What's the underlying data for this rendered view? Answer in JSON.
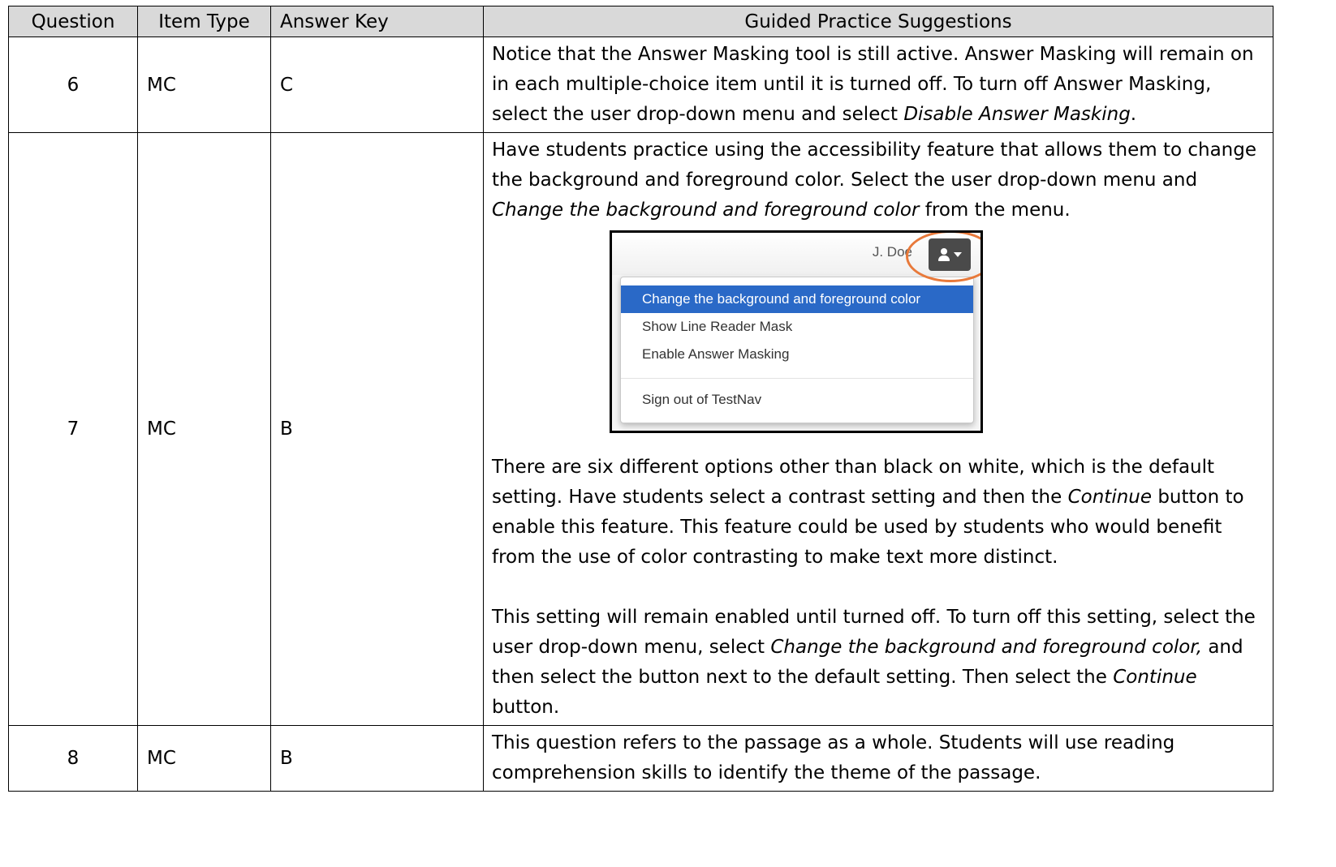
{
  "table": {
    "headers": [
      "Question",
      "Item Type",
      "Answer Key",
      "Guided Practice Suggestions"
    ],
    "rows": [
      {
        "question": "6",
        "item_type": "MC",
        "answer_key": "C",
        "text": "Notice that the Answer Masking tool is still active. Answer Masking will remain on in each multiple-choice item until it is turned off. To turn off Answer Masking, select the user drop-down menu and select ",
        "em": "Disable Answer Masking",
        "end": "."
      },
      {
        "question": "7",
        "item_type": "MC",
        "answer_key": "B",
        "p1": "Have students practice using the accessibility feature that allows them to change the background and foreground color. Select the user drop-down menu and ",
        "p1_em": "Change the background and foreground color",
        "p1_end": " from the menu.",
        "p2": "There are six different options other than black on white, which is the default setting. Have students select a contrast setting and then the ",
        "p2_em": "Continue",
        "p2_end": " button to enable this feature. This feature could be used by students who would benefit from the use of color contrasting to make text more distinct.",
        "p3": "This setting will remain enabled until turned off. To turn off this setting, select the user drop-down menu, select ",
        "p3_em": "Change the background and foreground color,",
        "p3_mid": " and then select the button next to the default setting. Then select the ",
        "p3_em2": "Continue",
        "p3_end": " button."
      },
      {
        "question": "8",
        "item_type": "MC",
        "answer_key": "B",
        "text": "This question refers to the passage as a whole. Students will use reading comprehension skills to identify the theme of the passage."
      }
    ]
  },
  "screenshot": {
    "user_name": "J. Doe",
    "user_button_icons": [
      "person-icon",
      "caret-down-icon"
    ],
    "menu_items": [
      "Change the background and foreground color",
      "Show Line Reader Mask",
      "Enable Answer Masking",
      "Sign out of TestNav"
    ],
    "active_item_color": "#2a69c7",
    "highlight_color": "#e8793a"
  }
}
